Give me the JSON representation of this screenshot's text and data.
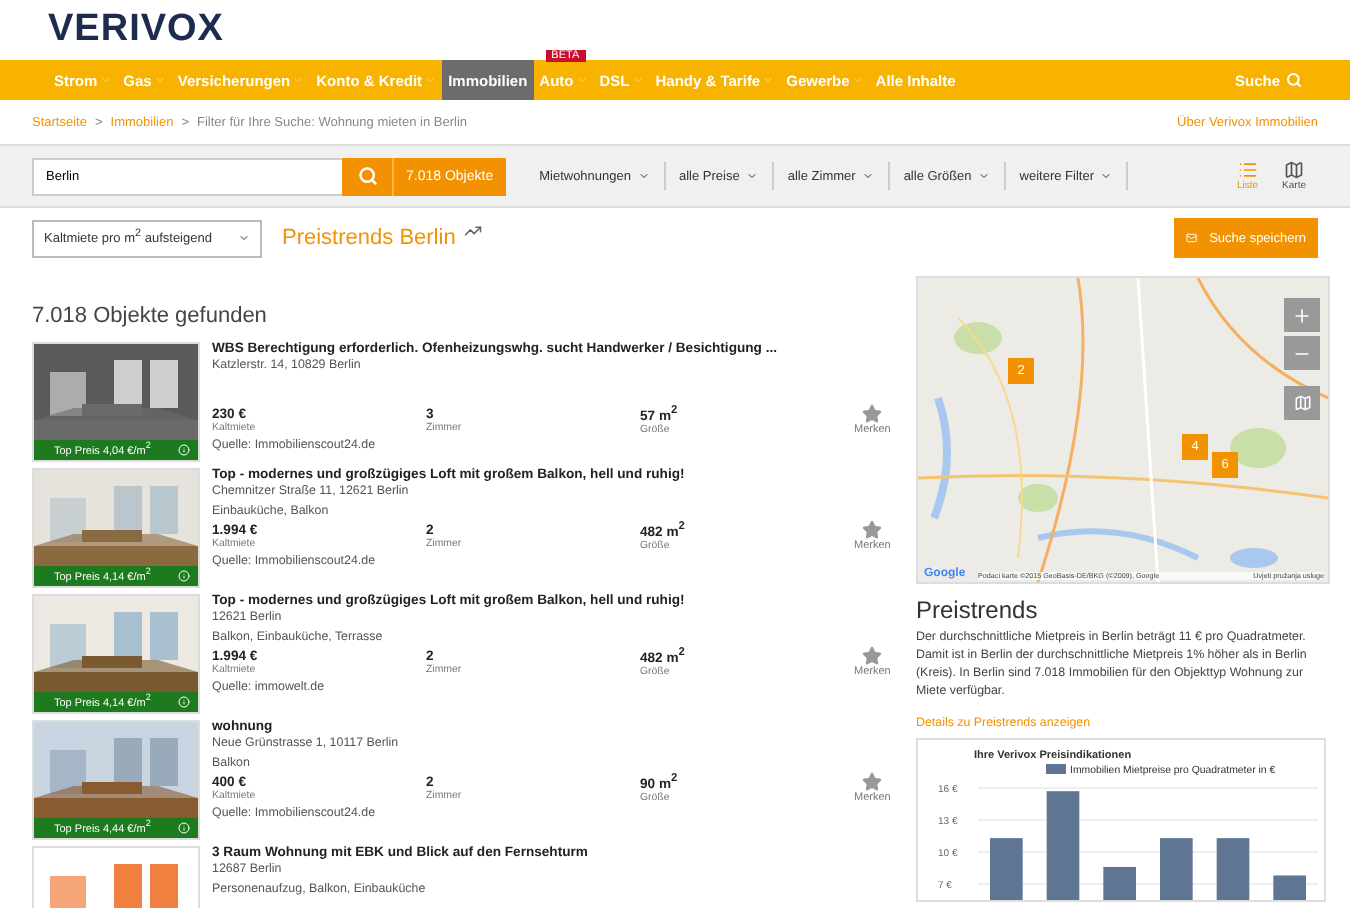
{
  "logo": {
    "text": "VERIVOX"
  },
  "nav": {
    "items": [
      {
        "label": "Strom",
        "dropdown": true,
        "selected": false
      },
      {
        "label": "Gas",
        "dropdown": true,
        "selected": false
      },
      {
        "label": "Versicherungen",
        "dropdown": true,
        "selected": false
      },
      {
        "label": "Konto & Kredit",
        "dropdown": true,
        "selected": false
      },
      {
        "label": "Immobilien",
        "dropdown": false,
        "selected": true
      },
      {
        "label": "Auto",
        "dropdown": true,
        "selected": false,
        "badge": "BETA"
      },
      {
        "label": "DSL",
        "dropdown": true,
        "selected": false
      },
      {
        "label": "Handy & Tarife",
        "dropdown": true,
        "selected": false
      },
      {
        "label": "Gewerbe",
        "dropdown": true,
        "selected": false
      },
      {
        "label": "Alle Inhalte",
        "dropdown": false,
        "selected": false
      }
    ],
    "search": "Suche"
  },
  "breadcrumb": {
    "items": [
      {
        "label": "Startseite",
        "kind": "link"
      },
      {
        "label": "Immobilien",
        "kind": "link"
      },
      {
        "label": "Filter für Ihre Suche: Wohnung mieten in Berlin",
        "kind": "current"
      }
    ],
    "separator": ">",
    "about_link": "Über Verivox Immobilien"
  },
  "filter_bar": {
    "location": "Berlin",
    "result_button": "7.018 Objekte",
    "filters": [
      "Mietwohnungen",
      "alle Preise",
      "alle Zimmer",
      "alle Größen",
      "weitere Filter"
    ],
    "views": [
      {
        "label": "Liste",
        "selected": true
      },
      {
        "label": "Karte",
        "selected": false
      }
    ]
  },
  "sort": {
    "value": "Kaltmiete pro m$^{2}$ aufsteigend"
  },
  "preistrends_link": "Preistrends Berlin",
  "save_search": "Suche speichern",
  "results_heading": "7.018 Objekte gefunden",
  "listings": [
    {
      "title": "WBS Berechtigung erforderlich. Ofenheizungswhg. sucht Handwerker / Besichtigung ...",
      "address": "Katzlerstr. 14, 10829 Berlin",
      "price": "230 €",
      "price_label": "Kaltmiete",
      "rooms": "3",
      "rooms_label": "Zimmer",
      "size": "57 m$^{2}$",
      "size_label": "Größe",
      "source": "Quelle: Immobilienscout24.de",
      "top_price": "Top Preis 4,04 €/m$^{2}$",
      "save": "Merken"
    },
    {
      "title": "Top - modernes und großzügiges Loft mit großem Balkon, hell und ruhig!",
      "address": "Chemnitzer Straße 11, 12621 Berlin",
      "features": "Einbauküche, Balkon",
      "price": "1.994 €",
      "price_label": "Kaltmiete",
      "rooms": "2",
      "rooms_label": "Zimmer",
      "size": "482 m$^{2}$",
      "size_label": "Größe",
      "source": "Quelle: Immobilienscout24.de",
      "top_price": "Top Preis 4,14 €/m$^{2}$",
      "save": "Merken"
    },
    {
      "title": "Top - modernes und großzügiges Loft mit großem Balkon, hell und ruhig!",
      "address": "12621 Berlin",
      "features": "Balkon, Einbauküche, Terrasse",
      "price": "1.994 €",
      "price_label": "Kaltmiete",
      "rooms": "2",
      "rooms_label": "Zimmer",
      "size": "482 m$^{2}$",
      "size_label": "Größe",
      "source": "Quelle: immowelt.de",
      "top_price": "Top Preis 4,14 €/m$^{2}$",
      "save": "Merken"
    },
    {
      "title": "wohnung",
      "address": "Neue Grünstrasse 1, 10117 Berlin",
      "features": "Balkon",
      "price": "400 €",
      "price_label": "Kaltmiete",
      "rooms": "2",
      "rooms_label": "Zimmer",
      "size": "90 m$^{2}$",
      "size_label": "Größe",
      "source": "Quelle: Immobilienscout24.de",
      "top_price": "Top Preis 4,44 €/m$^{2}$",
      "save": "Merken"
    },
    {
      "title": "3 Raum Wohnung mit EBK und Blick auf den Fernsehturm",
      "address": "12687 Berlin",
      "features": "Personenaufzug, Balkon, Einbauküche"
    }
  ],
  "map": {
    "provider": "Google",
    "clusters": [
      "2",
      "4",
      "6"
    ],
    "attribution": "Podaci karte ©2015 GeoBasis-DE/BKG (©2009), Google",
    "terms": "Uvjeti pružanja usluge"
  },
  "preistrends": {
    "heading": "Preistrends",
    "text": "Der durchschnittliche Mietpreis in Berlin beträgt 11 € pro Quadratmeter. Damit ist in Berlin der durchschnittliche Mietpreis 1% höher als in Berlin (Kreis). In Berlin sind 7.018 Immobilien für den Objekttyp Wohnung zur Miete verfügbar.",
    "details_link": "Details zu Preistrends anzeigen",
    "chart_data": {
      "type": "bar",
      "title": "Ihre Verivox Preisindikationen",
      "grid": true,
      "series": [
        {
          "name": "Immobilien Mietpreise pro Quadratmeter in €",
          "color": "#5f7594",
          "values": [
            11.3,
            15.7,
            8.6,
            11.3,
            11.3,
            7.8
          ]
        }
      ],
      "ylim": [
        5.5,
        16
      ],
      "yticks": [
        {
          "value": 16,
          "label": "16 €"
        },
        {
          "value": 13,
          "label": "13 €"
        },
        {
          "value": 10,
          "label": "10 €"
        },
        {
          "value": 7,
          "label": "7 €"
        }
      ]
    }
  }
}
